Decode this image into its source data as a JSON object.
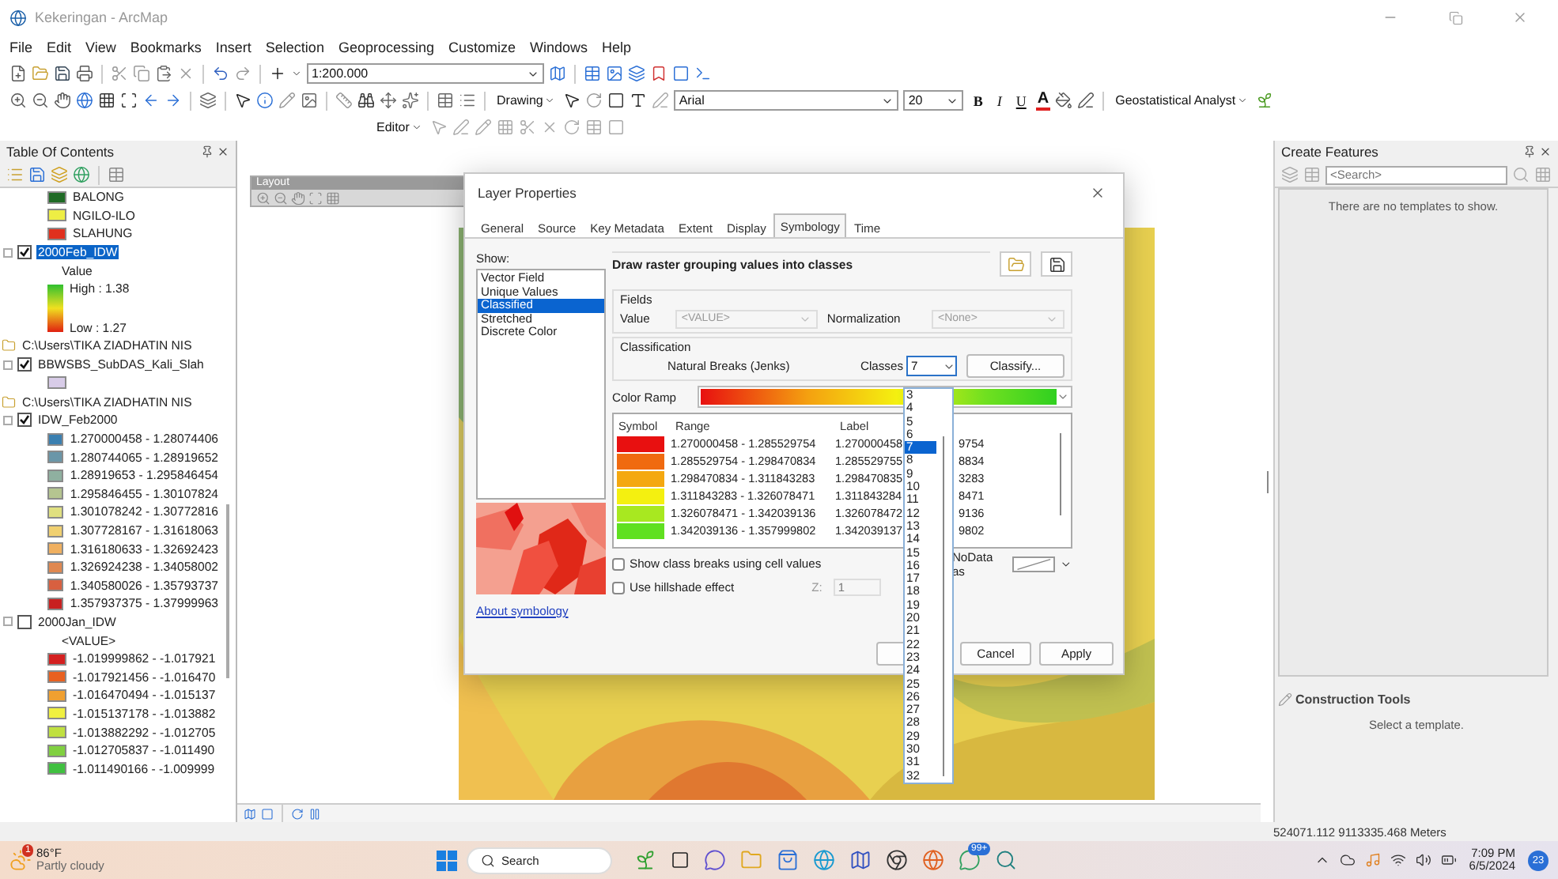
{
  "window": {
    "title": "Kekeringan - ArcMap"
  },
  "menu": [
    "File",
    "Edit",
    "View",
    "Bookmarks",
    "Insert",
    "Selection",
    "Geoprocessing",
    "Customize",
    "Windows",
    "Help"
  ],
  "toolbar": {
    "scale": "1:200.000",
    "drawing": "Drawing",
    "font": "Arial",
    "font_size": "20",
    "format_buttons": [
      "B",
      "I",
      "U"
    ],
    "font_color": "A",
    "geostat": "Geostatistical Analyst",
    "editor": "Editor"
  },
  "toc": {
    "title": "Table Of Contents",
    "items": [
      {
        "kind": "swatch",
        "label": "BALONG",
        "color": "#1f6a25"
      },
      {
        "kind": "swatch",
        "label": "NGILO-ILO",
        "color": "#eeee44"
      },
      {
        "kind": "swatch",
        "label": "SLAHUNG",
        "color": "#e0301e"
      },
      {
        "kind": "layer",
        "label": "2000Feb_IDW",
        "checked": true,
        "selected": true,
        "children": [
          {
            "kind": "text",
            "label": "Value"
          },
          {
            "kind": "ramp",
            "high": "High : 1.38",
            "low": "Low : 1.27"
          }
        ]
      },
      {
        "kind": "folder",
        "label": "C:\\Users\\TIKA ZIADHATIN NIS",
        "children": [
          {
            "kind": "layer",
            "label": "BBWSBS_SubDAS_Kali_Slah",
            "checked": true,
            "selected": false,
            "children": [
              {
                "kind": "swatch",
                "color": "#d8cce8"
              }
            ]
          }
        ]
      },
      {
        "kind": "folder",
        "label": "C:\\Users\\TIKA ZIADHATIN NIS",
        "children": [
          {
            "kind": "layer",
            "label": "IDW_Feb2000",
            "checked": true,
            "selected": false,
            "children": [
              {
                "kind": "swatch",
                "label": "1.270000458 - 1.28074406",
                "color": "#3a7fb0"
              },
              {
                "kind": "swatch",
                "label": "1.280744065 - 1.28919652",
                "color": "#6a96a8"
              },
              {
                "kind": "swatch",
                "label": "1.28919653 - 1.295846454",
                "color": "#8fb0a0"
              },
              {
                "kind": "swatch",
                "label": "1.295846455 - 1.30107824",
                "color": "#b5c590"
              },
              {
                "kind": "swatch",
                "label": "1.301078242 - 1.30772816",
                "color": "#e0e080"
              },
              {
                "kind": "swatch",
                "label": "1.307728167 - 1.31618063",
                "color": "#f0d070"
              },
              {
                "kind": "swatch",
                "label": "1.316180633 - 1.32692423",
                "color": "#f0b060"
              },
              {
                "kind": "swatch",
                "label": "1.326924238 - 1.34058002",
                "color": "#e08850"
              },
              {
                "kind": "swatch",
                "label": "1.340580026 - 1.35793737",
                "color": "#d86040"
              },
              {
                "kind": "swatch",
                "label": "1.357937375 - 1.37999963",
                "color": "#c82020"
              }
            ]
          },
          {
            "kind": "layer",
            "label": "2000Jan_IDW",
            "checked": false,
            "selected": false,
            "children": [
              {
                "kind": "text",
                "label": "<VALUE>"
              },
              {
                "kind": "swatch",
                "label": "-1.019999862 - -1.017921",
                "color": "#d42020"
              },
              {
                "kind": "swatch",
                "label": "-1.017921456 - -1.016470",
                "color": "#e86020"
              },
              {
                "kind": "swatch",
                "label": "-1.016470494 - -1.015137",
                "color": "#f0a030"
              },
              {
                "kind": "swatch",
                "label": "-1.015137178 - -1.013882",
                "color": "#f0f040"
              },
              {
                "kind": "swatch",
                "label": "-1.013882292 - -1.012705",
                "color": "#c0e040"
              },
              {
                "kind": "swatch",
                "label": "-1.012705837 - -1.011490",
                "color": "#80d040"
              },
              {
                "kind": "swatch",
                "label": "-1.011490166 - -1.009999",
                "color": "#40c040"
              }
            ]
          }
        ]
      }
    ]
  },
  "layout_toolbar": {
    "title": "Layout"
  },
  "dialog": {
    "title": "Layer Properties",
    "tabs": [
      {
        "label": "General",
        "selected": false
      },
      {
        "label": "Source",
        "selected": false
      },
      {
        "label": "Key Metadata",
        "selected": false
      },
      {
        "label": "Extent",
        "selected": false
      },
      {
        "label": "Display",
        "selected": false
      },
      {
        "label": "Symbology",
        "selected": true
      },
      {
        "label": "Time",
        "selected": false
      }
    ],
    "show_label": "Show:",
    "show_items": [
      {
        "label": "Vector Field",
        "selected": false
      },
      {
        "label": "Unique Values",
        "selected": false
      },
      {
        "label": "Classified",
        "selected": true
      },
      {
        "label": "Stretched",
        "selected": false
      },
      {
        "label": "Discrete Color",
        "selected": false
      }
    ],
    "about_link": "About symbology",
    "heading": "Draw raster grouping values into classes",
    "fields_label": "Fields",
    "value_label": "Value",
    "value": "<VALUE>",
    "normalization_label": "Normalization",
    "normalization": "<None>",
    "classification_label": "Classification",
    "method": "Natural Breaks (Jenks)",
    "classes_label": "Classes",
    "classes_value": "7",
    "classify_button": "Classify...",
    "color_ramp_label": "Color Ramp",
    "columns": [
      "Symbol",
      "Range",
      "Label"
    ],
    "rows": [
      {
        "color": "#e81010",
        "range": "1.270000458 - 1.285529754",
        "label_start": "1.270000458",
        "label_end": "9754"
      },
      {
        "color": "#f06a10",
        "range": "1.285529754 - 1.298470834",
        "label_start": "1.285529755",
        "label_end": "8834"
      },
      {
        "color": "#f4a810",
        "range": "1.298470834 - 1.311843283",
        "label_start": "1.298470835",
        "label_end": "3283"
      },
      {
        "color": "#f4f010",
        "range": "1.311843283 - 1.326078471",
        "label_start": "1.311843284",
        "label_end": "8471"
      },
      {
        "color": "#a8e820",
        "range": "1.326078471 - 1.342039136",
        "label_start": "1.326078472",
        "label_end": "9136"
      },
      {
        "color": "#60e020",
        "range": "1.342039136 - 1.357999802",
        "label_start": "1.342039137",
        "label_end": "9802"
      }
    ],
    "options": [
      {
        "label": "Show class breaks using cell values",
        "checked": false
      },
      {
        "label": "Use hillshade effect",
        "checked": false
      }
    ],
    "z_label": "Z:",
    "z_value": "1",
    "nodata_label": "NoData as",
    "buttons": [
      "Cancel",
      "Apply"
    ],
    "classes_list": [
      {
        "label": "3",
        "selected": false
      },
      {
        "label": "4",
        "selected": false
      },
      {
        "label": "5",
        "selected": false
      },
      {
        "label": "6",
        "selected": false
      },
      {
        "label": "7",
        "selected": true
      },
      {
        "label": "8",
        "selected": false
      },
      {
        "label": "9",
        "selected": false
      },
      {
        "label": "10",
        "selected": false
      },
      {
        "label": "11",
        "selected": false
      },
      {
        "label": "12",
        "selected": false
      },
      {
        "label": "13",
        "selected": false
      },
      {
        "label": "14",
        "selected": false
      },
      {
        "label": "15",
        "selected": false
      },
      {
        "label": "16",
        "selected": false
      },
      {
        "label": "17",
        "selected": false
      },
      {
        "label": "18",
        "selected": false
      },
      {
        "label": "19",
        "selected": false
      },
      {
        "label": "20",
        "selected": false
      },
      {
        "label": "21",
        "selected": false
      },
      {
        "label": "22",
        "selected": false
      },
      {
        "label": "23",
        "selected": false
      },
      {
        "label": "24",
        "selected": false
      },
      {
        "label": "25",
        "selected": false
      },
      {
        "label": "26",
        "selected": false
      },
      {
        "label": "27",
        "selected": false
      },
      {
        "label": "28",
        "selected": false
      },
      {
        "label": "29",
        "selected": false
      },
      {
        "label": "30",
        "selected": false
      },
      {
        "label": "31",
        "selected": false
      },
      {
        "label": "32",
        "selected": false
      }
    ]
  },
  "create_features": {
    "title": "Create Features",
    "search_placeholder": "<Search>",
    "empty": "There are no templates to show.",
    "construction_title": "Construction Tools",
    "construction_hint": "Select a template."
  },
  "status_bar": {
    "coordinates": "524071.112  9113335.468 Meters"
  },
  "taskbar": {
    "weather_badge": "1",
    "temperature": "86°F",
    "condition": "Partly cloudy",
    "search": "Search",
    "chat_badge": "99+",
    "time": "7:09 PM",
    "date": "6/5/2024",
    "notifications": "23"
  }
}
